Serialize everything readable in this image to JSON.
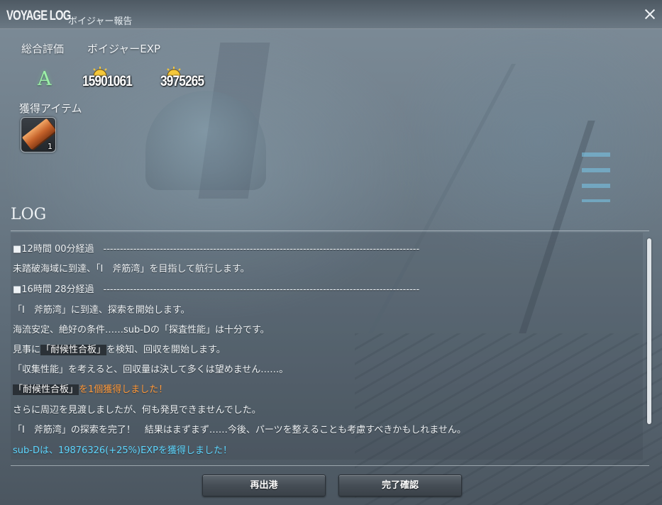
{
  "window": {
    "title_en": "VOYAGE LOG",
    "title_jp": "ボイジャー報告",
    "close_icon": "close-icon"
  },
  "results": {
    "rating_label": "総合評価",
    "exp_label": "ボイジャーEXP",
    "rating_value": "A",
    "exp_value_1": "15901061",
    "exp_value_2": "3975265",
    "exp_icon": "sun-icon"
  },
  "items": {
    "label": "獲得アイテム",
    "list": [
      {
        "icon": "plank-icon",
        "quantity": "1"
      }
    ]
  },
  "log": {
    "title": "LOG",
    "lines": [
      {
        "text": "■12時間 00分経過　-----------------------------------------------------------------------------------------------"
      },
      {
        "text": "未踏破海域に到達、「I　斧筋湾」を目指して航行します。"
      },
      {
        "text": "■16時間 28分経過　-----------------------------------------------------------------------------------------------"
      },
      {
        "text": "「I　斧筋湾」に到達、探索を開始します。"
      },
      {
        "text": "海流安定、絶好の条件……sub-Dの「探査性能」は十分です。"
      },
      {
        "pre": "見事に",
        "hl": "「耐候性合板」",
        "post": "を検知、回収を開始します。"
      },
      {
        "text": "「収集性能」を考えると、回収量は決して多くは望めません……。"
      },
      {
        "hl": "「耐候性合板」",
        "post": "を1個獲得しました！",
        "color": "#ff9a3c"
      },
      {
        "text": "さらに周辺を見渡しましたが、何も発見できませんでした。"
      },
      {
        "text": "「I　斧筋湾」の探索を完了！　結果はまずまず……今後、パーツを整えることも考慮すべきかもしれません。"
      },
      {
        "text": "sub-Dは、19876326(+25%)EXPを獲得しました！",
        "color": "#5fd7ff"
      }
    ]
  },
  "buttons": {
    "redeploy": "再出港",
    "finalize": "完了確認"
  },
  "colors": {
    "grade": "#9df0a8",
    "item_obtained": "#ff9a3c",
    "exp_gained": "#5fd7ff"
  }
}
